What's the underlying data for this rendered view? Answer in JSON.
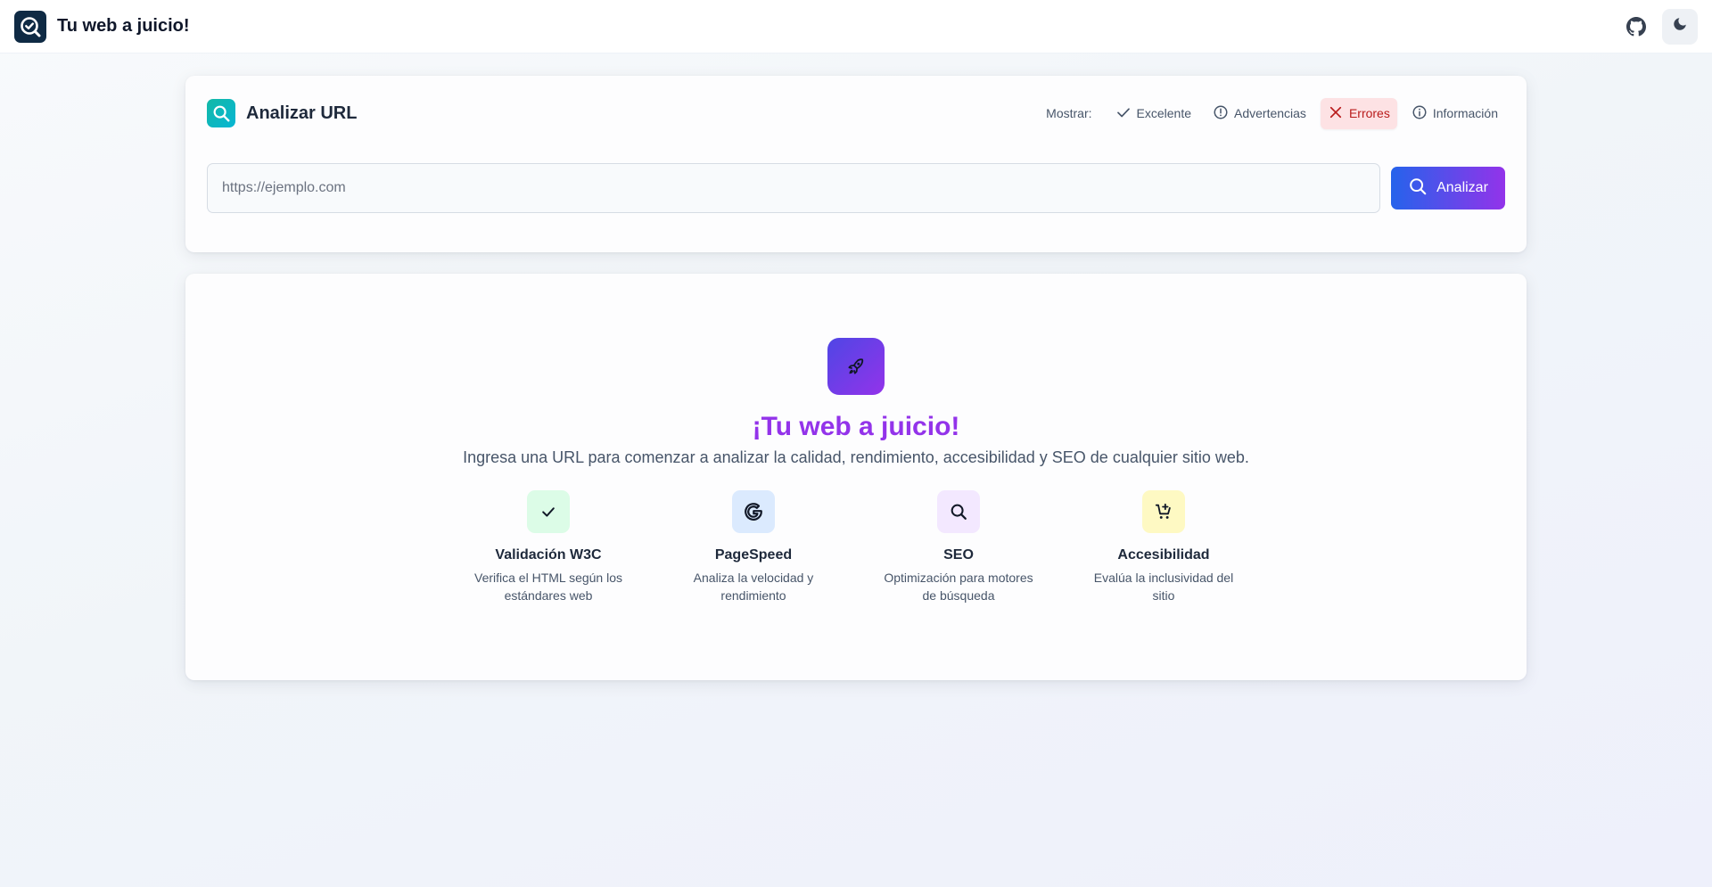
{
  "header": {
    "title": "Tu web a juicio!",
    "github_icon": "github-icon",
    "theme_icon": "moon-icon"
  },
  "analyze": {
    "title": "Analizar URL",
    "show_label": "Mostrar:",
    "filters": [
      {
        "label": "Excelente",
        "icon": "check-icon",
        "active": false
      },
      {
        "label": "Advertencias",
        "icon": "alert-circle-icon",
        "active": false
      },
      {
        "label": "Errores",
        "icon": "x-icon",
        "active": true
      },
      {
        "label": "Información",
        "icon": "info-icon",
        "active": false
      }
    ],
    "url_placeholder": "https://ejemplo.com",
    "url_value": "",
    "button_label": "Analizar"
  },
  "welcome": {
    "title": "¡Tu web a juicio!",
    "subtitle": "Ingresa una URL para comenzar a analizar la calidad, rendimiento, accesibilidad y SEO de cualquier sitio web.",
    "features": [
      {
        "title": "Validación W3C",
        "desc": "Verifica el HTML según los estándares web",
        "icon": "check-icon",
        "color": "#dcfce7"
      },
      {
        "title": "PageSpeed",
        "desc": "Analiza la velocidad y rendimiento",
        "icon": "google-icon",
        "color": "#dbeafe"
      },
      {
        "title": "SEO",
        "desc": "Optimización para motores de búsqueda",
        "icon": "search-icon",
        "color": "#f3e8ff"
      },
      {
        "title": "Accesibilidad",
        "desc": "Evalúa la inclusividad del sitio",
        "icon": "cart-plus-icon",
        "color": "#fef9c3"
      }
    ]
  },
  "colors": {
    "accent_start": "#2563eb",
    "accent_end": "#9333ea",
    "error_bg": "#fde2e4",
    "error_text": "#b91c1c"
  }
}
